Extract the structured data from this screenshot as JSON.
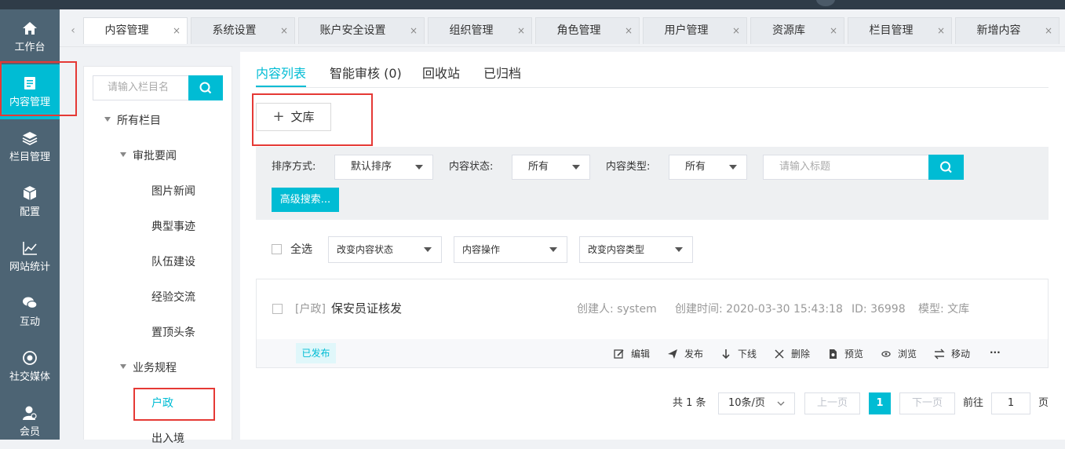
{
  "sidebar": {
    "items": [
      {
        "label": "工作台",
        "icon": "home-icon"
      },
      {
        "label": "内容管理",
        "icon": "document-icon",
        "active": true
      },
      {
        "label": "栏目管理",
        "icon": "layers-icon"
      },
      {
        "label": "配置",
        "icon": "cube-icon"
      },
      {
        "label": "网站统计",
        "icon": "chart-icon"
      },
      {
        "label": "互动",
        "icon": "chat-icon"
      },
      {
        "label": "社交媒体",
        "icon": "social-icon"
      },
      {
        "label": "会员",
        "icon": "member-icon"
      }
    ]
  },
  "tabs": [
    {
      "label": "内容管理",
      "active": true
    },
    {
      "label": "系统设置"
    },
    {
      "label": "账户安全设置"
    },
    {
      "label": "组织管理"
    },
    {
      "label": "角色管理"
    },
    {
      "label": "用户管理"
    },
    {
      "label": "资源库"
    },
    {
      "label": "栏目管理"
    },
    {
      "label": "新增内容"
    }
  ],
  "tree": {
    "search_placeholder": "请输入栏目名",
    "nodes": [
      "所有栏目",
      "审批要闻",
      "图片新闻",
      "典型事迹",
      "队伍建设",
      "经验交流",
      "置顶头条",
      "业务规程",
      "户政",
      "出入境"
    ]
  },
  "content_tabs": [
    "内容列表",
    "智能审核 (0)",
    "回收站",
    "已归档"
  ],
  "add_button": "文库",
  "filters": {
    "sort_label": "排序方式:",
    "sort_value": "默认排序",
    "status_label": "内容状态:",
    "status_value": "所有",
    "type_label": "内容类型:",
    "type_value": "所有",
    "title_placeholder": "请输入标题",
    "advanced": "高级搜索..."
  },
  "batch": {
    "select_all": "全选",
    "change_status": "改变内容状态",
    "operations": "内容操作",
    "change_type": "改变内容类型"
  },
  "item": {
    "category": "[户政]",
    "title": "保安员证核发",
    "creator": "创建人: system",
    "created": "创建时间: 2020-03-30 15:43:18",
    "id": "ID: 36998",
    "model": "模型: 文库",
    "status": "已发布",
    "actions": [
      "编辑",
      "发布",
      "下线",
      "删除",
      "预览",
      "浏览",
      "移动",
      "···"
    ]
  },
  "pagination": {
    "total": "共 1 条",
    "page_size": "10条/页",
    "prev": "上一页",
    "current": "1",
    "next": "下一页",
    "goto_label": "前往",
    "goto_value": "1",
    "page_suffix": "页"
  },
  "colors": {
    "accent": "#00bcd4",
    "sidebar": "#4d6474",
    "highlight": "#e53935"
  }
}
